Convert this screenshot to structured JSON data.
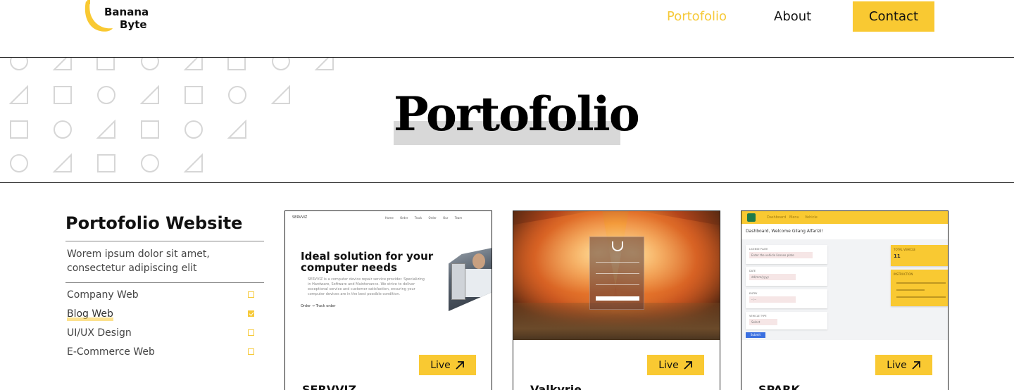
{
  "brand": {
    "line1": "Banana",
    "line2": "Byte",
    "accent": "#F9C932"
  },
  "nav": {
    "portfolio": "Portofolio",
    "about": "About",
    "contact": "Contact"
  },
  "hero": {
    "title": "Portofolio"
  },
  "sidebar": {
    "title": "Portofolio Website",
    "description": "Worem ipsum dolor sit amet, consectetur adipiscing elit",
    "filters": [
      {
        "label": "Company Web",
        "checked": false
      },
      {
        "label": "Blog Web",
        "checked": true
      },
      {
        "label": "UI/UX Design",
        "checked": false
      },
      {
        "label": "E-Commerce Web",
        "checked": false
      }
    ]
  },
  "projects": [
    {
      "name": "SERVVIZ",
      "live_label": "Live",
      "preview": {
        "brand": "SERVVIZ",
        "links": "Home Order Track Order Our Team",
        "headline": "Ideal solution for your computer needs",
        "body": "SERVVIZ is a computer device repair service provider. Specializing in Hardware, Software and Maintenance. We strive to deliver exceptional service and customer satisfaction, ensuring your computer devices are in the best possible condition.",
        "cta": "Order → Track order"
      }
    },
    {
      "name": "Valkyrie",
      "live_label": "Live"
    },
    {
      "name": "SPARK",
      "live_label": "Live",
      "preview": {
        "tabs": [
          "Dashboard",
          "Menu",
          "Vehicle"
        ],
        "welcome": "Dashboard, Welcome Gilang Alfarizi!",
        "fields": [
          {
            "label": "LICENSE PLATE",
            "value": "Enter the vehicle license plate"
          },
          {
            "label": "DATE",
            "value": "dd/mm/yyyy"
          },
          {
            "label": "ENTRY",
            "value": "--:--"
          },
          {
            "label": "VEHICLE TYPE",
            "value": "Select"
          }
        ],
        "submit": "Submit",
        "total_label": "TOTAL VEHICLE",
        "total_value": "11",
        "instructions_label": "INSTRUCTION"
      }
    }
  ]
}
